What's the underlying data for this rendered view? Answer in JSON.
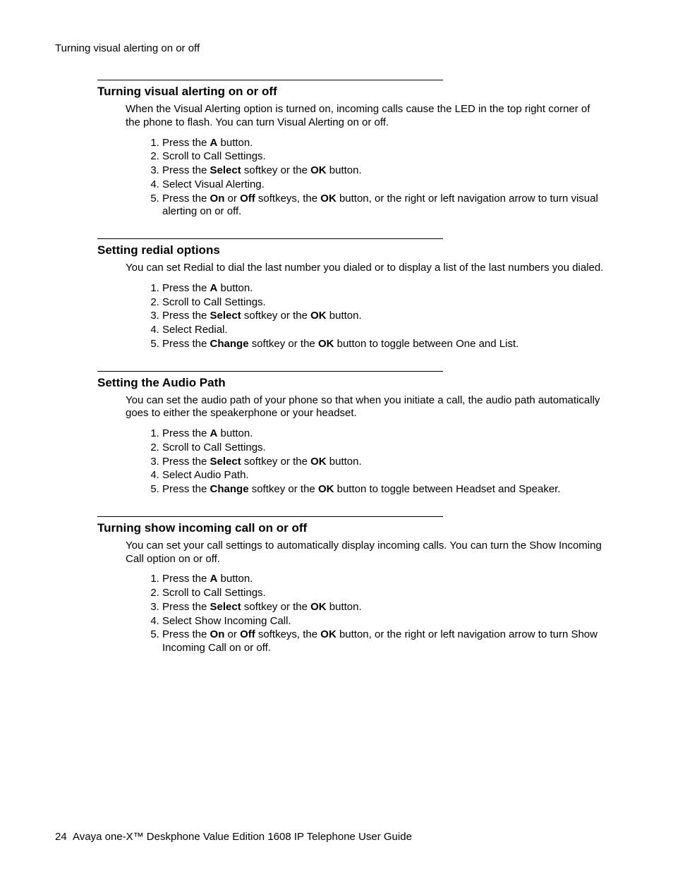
{
  "running_header": "Turning visual alerting on or off",
  "sections": [
    {
      "heading": "Turning visual alerting on or off",
      "intro": "When the Visual Alerting option is turned on, incoming calls cause the LED in the top right corner of the phone to flash. You can turn Visual Alerting on or off.",
      "steps": [
        "Press the <b>A</b> button.",
        "Scroll to Call Settings.",
        "Press the <b>Select</b> softkey or the <b>OK</b> button.",
        "Select Visual Alerting.",
        "Press the <b>On</b> or <b>Off</b> softkeys, the <b>OK</b> button, or the right or left navigation arrow to turn visual alerting on or off."
      ]
    },
    {
      "heading": "Setting redial options",
      "intro": "You can set Redial to dial the last number you dialed or to display a list of the last numbers you dialed.",
      "steps": [
        "Press the <b>A</b> button.",
        "Scroll to Call Settings.",
        "Press the <b>Select</b> softkey or the <b>OK</b> button.",
        "Select Redial.",
        "Press the <b>Change</b> softkey or the <b>OK</b> button to toggle between One and List."
      ]
    },
    {
      "heading": "Setting the Audio Path",
      "intro": "You can set the audio path of your phone so that when you initiate a call, the audio path automatically goes to either the speakerphone or your headset.",
      "steps": [
        "Press the <b>A</b> button.",
        "Scroll to Call Settings.",
        "Press the <b>Select</b> softkey or the <b>OK</b> button.",
        "Select Audio Path.",
        "Press the <b>Change</b> softkey or the <b>OK</b> button to toggle between Headset and Speaker."
      ]
    },
    {
      "heading": "Turning show incoming call on or off",
      "intro": "You can set your call settings to automatically display incoming calls. You can turn the Show Incoming Call option on or off.",
      "steps": [
        "Press the <b>A</b> button.",
        "Scroll to Call Settings.",
        "Press the <b>Select</b> softkey or the <b>OK</b> button.",
        "Select Show Incoming Call.",
        "Press the <b>On</b> or <b>Off</b> softkeys, the <b>OK</b> button, or the right or left navigation arrow to turn Show Incoming Call on or off."
      ]
    }
  ],
  "footer": {
    "page_number": "24",
    "title": "Avaya one-X™ Deskphone Value Edition 1608 IP Telephone User Guide"
  }
}
